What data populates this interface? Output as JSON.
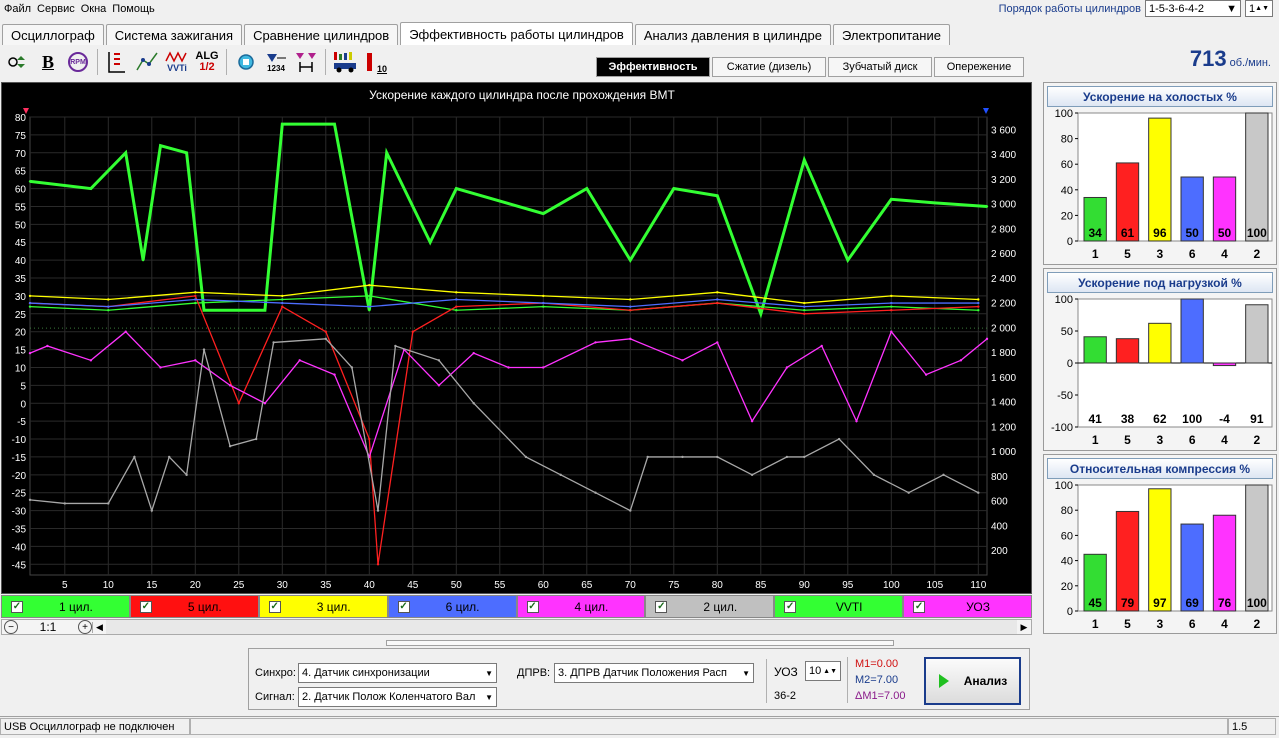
{
  "menu": [
    "Файл",
    "Сервис",
    "Окна",
    "Помощь"
  ],
  "cyl_order": {
    "label": "Порядок работы цилиндров",
    "value": "1-5-3-6-4-2",
    "num": "1"
  },
  "tabs": [
    "Осциллограф",
    "Система зажигания",
    "Сравнение цилиндров",
    "Эффективность работы цилиндров",
    "Анализ давления в цилиндре",
    "Электропитание"
  ],
  "toolbar": {
    "bold": "B",
    "rpm": "RPM",
    "alg": "ALG",
    "alg2": "1/2",
    "vvti": "VVTi",
    "num1234": "1234",
    "num10": "10"
  },
  "subtabs": [
    "Эффективность",
    "Сжатие (дизель)",
    "Зубчатый диск",
    "Опережение"
  ],
  "rpm": {
    "value": "713",
    "unit": "об./мин."
  },
  "chart": {
    "title": "Ускорение каждого цилиндра после прохождения ВМТ",
    "y_ticks": [
      "80",
      "75",
      "70",
      "65",
      "60",
      "55",
      "50",
      "45",
      "40",
      "35",
      "30",
      "25",
      "20",
      "15",
      "10",
      "5",
      "0",
      "-5",
      "-10",
      "-15",
      "-20",
      "-25",
      "-30",
      "-35",
      "-40",
      "-45"
    ],
    "y2_ticks": [
      "3 600",
      "3 400",
      "3 200",
      "3 000",
      "2 800",
      "2 600",
      "2 400",
      "2 200",
      "2 000",
      "1 800",
      "1 600",
      "1 400",
      "1 200",
      "1 000",
      "800",
      "600",
      "400",
      "200"
    ],
    "x_ticks": [
      "5",
      "10",
      "15",
      "20",
      "25",
      "30",
      "35",
      "40",
      "45",
      "50",
      "55",
      "60",
      "65",
      "70",
      "75",
      "80",
      "85",
      "90",
      "95",
      "100",
      "105",
      "110"
    ]
  },
  "chart_data": {
    "type": "line",
    "title": "Ускорение каждого цилиндра после прохождения ВМТ",
    "xlim": [
      1,
      111
    ],
    "ylim": [
      -48,
      80
    ],
    "y2lim": [
      0,
      3700
    ],
    "series": [
      {
        "name": "VVTI",
        "color": "#33ff33",
        "x": [
          1,
          8,
          12,
          14,
          16,
          19,
          21,
          28,
          30,
          36,
          40,
          42,
          47,
          50,
          60,
          65,
          70,
          75,
          80,
          85,
          90,
          95,
          100,
          105,
          111
        ],
        "y": [
          62,
          60,
          70,
          40,
          72,
          70,
          26,
          26,
          78,
          78,
          26,
          70,
          45,
          60,
          53,
          60,
          40,
          60,
          58,
          25,
          68,
          40,
          57,
          56,
          55
        ]
      },
      {
        "name": "1 цил.",
        "color": "#33ff33",
        "x": [
          1,
          10,
          20,
          30,
          40,
          50,
          60,
          70,
          80,
          90,
          100,
          110
        ],
        "y": [
          27,
          26,
          28,
          29,
          30,
          26,
          27,
          26,
          28,
          26,
          27,
          26
        ]
      },
      {
        "name": "5 цил.",
        "color": "#ff2020",
        "x": [
          1,
          10,
          20,
          25,
          30,
          35,
          40,
          41,
          45,
          50,
          60,
          70,
          80,
          90,
          100,
          110
        ],
        "y": [
          28,
          27,
          30,
          0,
          27,
          20,
          -10,
          -45,
          20,
          27,
          28,
          26,
          28,
          25,
          26,
          27
        ]
      },
      {
        "name": "3 цил.",
        "color": "#ffff00",
        "x": [
          1,
          10,
          20,
          30,
          40,
          50,
          60,
          70,
          80,
          90,
          100,
          110
        ],
        "y": [
          30,
          29,
          31,
          30,
          33,
          31,
          30,
          29,
          31,
          28,
          30,
          29
        ]
      },
      {
        "name": "6 цил.",
        "color": "#4d6dff",
        "x": [
          1,
          10,
          20,
          30,
          40,
          50,
          60,
          70,
          80,
          90,
          100,
          110
        ],
        "y": [
          28,
          27,
          29,
          28,
          27,
          29,
          28,
          27,
          29,
          27,
          28,
          28
        ]
      },
      {
        "name": "4 цил.",
        "color": "#ff33ff",
        "x": [
          1,
          3,
          8,
          12,
          16,
          20,
          24,
          28,
          32,
          36,
          40,
          44,
          48,
          52,
          56,
          60,
          66,
          70,
          76,
          80,
          84,
          88,
          92,
          96,
          100,
          104,
          108,
          111
        ],
        "y": [
          14,
          16,
          12,
          20,
          10,
          12,
          5,
          0,
          12,
          8,
          -15,
          15,
          5,
          14,
          10,
          10,
          17,
          18,
          12,
          17,
          -5,
          10,
          16,
          -5,
          20,
          8,
          12,
          18
        ]
      },
      {
        "name": "2 цил.",
        "color": "#a8a8a8",
        "x": [
          1,
          5,
          10,
          13,
          15,
          17,
          19,
          21,
          24,
          27,
          29,
          35,
          38,
          41,
          43,
          48,
          52,
          58,
          62,
          66,
          70,
          72,
          76,
          80,
          84,
          88,
          90,
          94,
          98,
          102,
          106,
          110
        ],
        "y": [
          -27,
          -28,
          -28,
          -15,
          -30,
          -15,
          -20,
          15,
          -12,
          -10,
          17,
          18,
          10,
          -30,
          16,
          12,
          0,
          -15,
          -20,
          -25,
          -30,
          -15,
          -15,
          -15,
          -20,
          -15,
          -15,
          -10,
          -20,
          -25,
          -20,
          -25
        ]
      }
    ]
  },
  "legend": [
    {
      "label": "1 цил.",
      "bg": "#33ff33",
      "fg": "#000"
    },
    {
      "label": "5 цил.",
      "bg": "#ff1010",
      "fg": "#000"
    },
    {
      "label": "3 цил.",
      "bg": "#ffff00",
      "fg": "#000"
    },
    {
      "label": "6 цил.",
      "bg": "#4d6dff",
      "fg": "#000"
    },
    {
      "label": "4 цил.",
      "bg": "#ff33ff",
      "fg": "#000"
    },
    {
      "label": "2 цил.",
      "bg": "#c0c0c0",
      "fg": "#000"
    },
    {
      "label": "VVTI",
      "bg": "#33ff33",
      "fg": "#000"
    },
    {
      "label": "УОЗ",
      "bg": "#ff33ff",
      "fg": "#000"
    }
  ],
  "zoom": {
    "value": "1:1"
  },
  "panels": [
    {
      "title": "Ускорение на холостых %",
      "ymin": 0,
      "ymax": 100,
      "ticks": [
        "100",
        "80",
        "60",
        "40",
        "20",
        "0"
      ],
      "categories": [
        "1",
        "5",
        "3",
        "6",
        "4",
        "2"
      ],
      "values": [
        34,
        61,
        96,
        50,
        50,
        100
      ],
      "labels": [
        "34",
        "61",
        "96",
        "50",
        "50",
        "100"
      ]
    },
    {
      "title": "Ускорение под нагрузкой %",
      "ymin": -100,
      "ymax": 100,
      "ticks": [
        "100",
        "50",
        "0",
        "-50",
        "-100"
      ],
      "categories": [
        "1",
        "5",
        "3",
        "6",
        "4",
        "2"
      ],
      "values": [
        41,
        38,
        62,
        100,
        -4,
        91
      ],
      "labels": [
        "41",
        "38",
        "62",
        "100",
        "-4",
        "91"
      ]
    },
    {
      "title": "Относительная компрессия %",
      "ymin": 0,
      "ymax": 100,
      "ticks": [
        "100",
        "80",
        "60",
        "40",
        "20",
        "0"
      ],
      "categories": [
        "1",
        "5",
        "3",
        "6",
        "4",
        "2"
      ],
      "values": [
        45,
        79,
        97,
        69,
        76,
        100
      ],
      "labels": [
        "45",
        "79",
        "97",
        "69",
        "76",
        "100"
      ]
    }
  ],
  "bar_colors": [
    "#33dd33",
    "#ff2020",
    "#ffff00",
    "#4d6dff",
    "#ff33ff",
    "#c8c8c8"
  ],
  "bottom": {
    "sync_label": "Синхро:",
    "sync_value": "4.  Датчик синхронизации",
    "signal_label": "Сигнал:",
    "signal_value": "2.  Датчик Полож Коленчатого Вал",
    "dprv_label": "ДПРВ:",
    "dprv_value": "3.  ДПРВ Датчик Положения Расп",
    "uoz_label": "УОЗ",
    "uoz_value": "10",
    "teeth": "36-2",
    "m1": "M1=0.00",
    "m2": "M2=7.00",
    "dm1": "ΔM1=7.00",
    "analyze": "Анализ"
  },
  "status": {
    "left": "USB Осциллограф не подключен",
    "right": "1.5"
  }
}
